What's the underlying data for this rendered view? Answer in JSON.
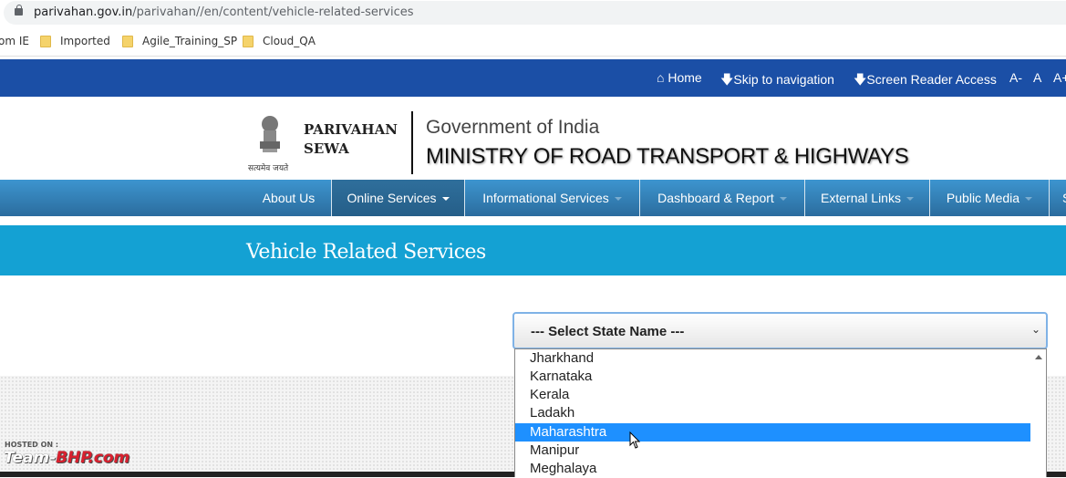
{
  "browser": {
    "url_host": "parivahan.gov.in",
    "url_path": "/parivahan//en/content/vehicle-related-services",
    "bookmarks": [
      {
        "label": "om IE",
        "folder": false
      },
      {
        "label": "Imported",
        "folder": true
      },
      {
        "label": "Agile_Training_SP",
        "folder": true
      },
      {
        "label": "Cloud_QA",
        "folder": true
      }
    ]
  },
  "topbar": {
    "home": "Home",
    "skip": "Skip to navigation",
    "reader": "Screen Reader Access",
    "font_small": "A-",
    "font_normal": "A",
    "font_large": "A+"
  },
  "header": {
    "brand_line1": "PARIVAHAN",
    "brand_line2": "SEWA",
    "emblem_motto": "सत्यमेव जयते",
    "gov": "Government of India",
    "ministry": "MINISTRY OF ROAD TRANSPORT & HIGHWAYS"
  },
  "nav": {
    "items": [
      {
        "label": "About Us"
      },
      {
        "label": "Online Services"
      },
      {
        "label": "Informational Services"
      },
      {
        "label": "Dashboard & Report"
      },
      {
        "label": "External Links"
      },
      {
        "label": "Public Media"
      },
      {
        "label": "S"
      }
    ]
  },
  "banner": {
    "title": "Vehicle Related Services"
  },
  "state_select": {
    "value": "--- Select State Name ---",
    "options": [
      "Jharkhand",
      "Karnataka",
      "Kerala",
      "Ladakh",
      "Maharashtra",
      "Manipur",
      "Meghalaya"
    ],
    "highlighted": "Maharashtra"
  },
  "watermark": {
    "hosted": "HOSTED ON :",
    "brand": "Team-BHP.com"
  },
  "colors": {
    "topbar": "#1b4fa6",
    "nav": "#3d95cf",
    "banner": "#14a1d3",
    "highlight": "#1e90ff"
  }
}
